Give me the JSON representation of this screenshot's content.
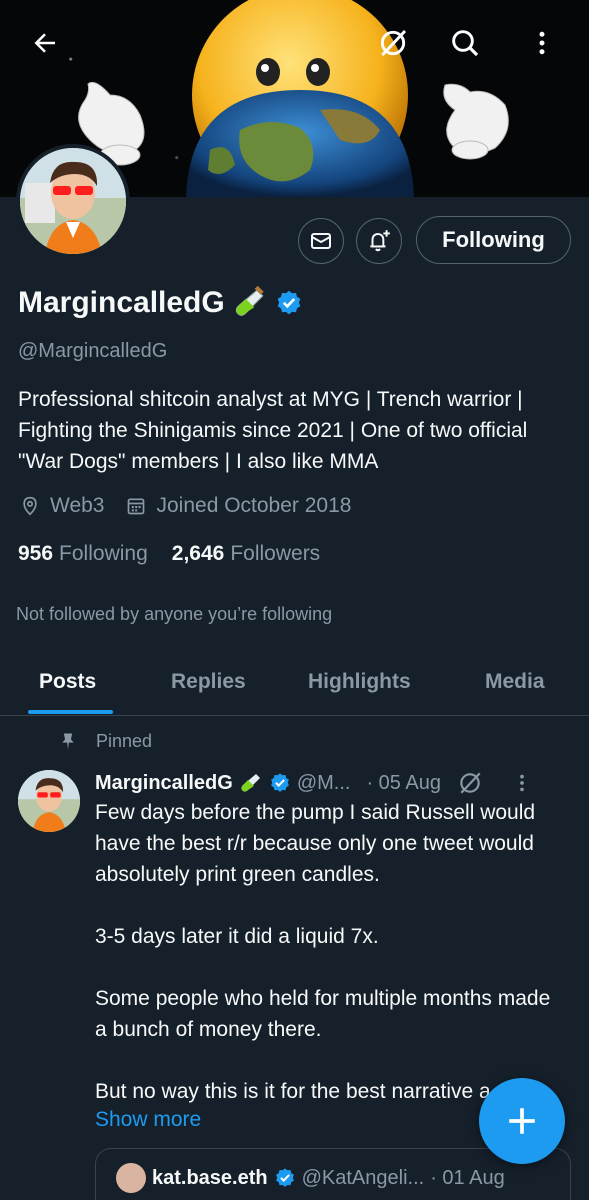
{
  "profile": {
    "display_name": "MargincalledG",
    "handle": "@MargincalledG",
    "bio": "Professional shitcoin analyst at MYG | Trench warrior | Fighting the Shinigamis since 2021 | One of two official \"War Dogs\" members | I also like MMA",
    "location": "Web3",
    "joined": "Joined October 2018",
    "following_count": "956",
    "following_label": "Following",
    "followers_count": "2,646",
    "followers_label": "Followers",
    "not_followed_text": "Not followed by anyone you’re following"
  },
  "actions": {
    "following_button": "Following"
  },
  "tabs": [
    {
      "label": "Posts",
      "active": true
    },
    {
      "label": "Replies",
      "active": false
    },
    {
      "label": "Highlights",
      "active": false
    },
    {
      "label": "Media",
      "active": false
    }
  ],
  "pinned_post": {
    "pinned_label": "Pinned",
    "author_name": "MargincalledG",
    "author_handle": "@M...",
    "date": "· 05 Aug",
    "text": "Few days before the pump I said Russell would have the best r/r because only one tweet would absolutely print green candles.\n\n3-5 days later it did a liquid 7x.\n\nSome people who held for multiple months made a bunch of money there.\n\nBut no way this is it for the best narrative a",
    "show_more": "Show more",
    "quote": {
      "author_name": "kat.base.eth",
      "author_handle": "@KatAngeli...",
      "date": "· 01 Aug"
    }
  },
  "colors": {
    "background": "#15202b",
    "accent": "#1d9bf0",
    "muted": "#8b98a5",
    "border": "#38444d"
  },
  "icons": [
    "back-arrow-icon",
    "grok-icon",
    "search-icon",
    "more-vertical-icon",
    "mail-icon",
    "bell-plus-icon",
    "verified-badge-icon",
    "test-tube-icon",
    "location-icon",
    "calendar-icon",
    "pin-icon",
    "compose-plus-icon"
  ]
}
